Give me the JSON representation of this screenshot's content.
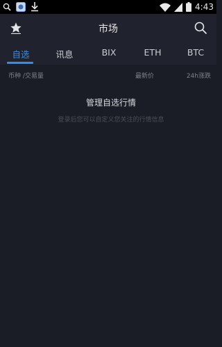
{
  "status_bar": {
    "time": "4:43",
    "icons": [
      "search-icon",
      "app-icon",
      "download-icon",
      "wifi-icon",
      "signal-icon",
      "battery-icon"
    ]
  },
  "header": {
    "title": "市场",
    "left_icon": "star-icon",
    "right_icon": "search-icon"
  },
  "tabs": [
    {
      "label": "自选",
      "active": true
    },
    {
      "label": "讯息",
      "active": false
    },
    {
      "label": "BIX",
      "active": false
    },
    {
      "label": "ETH",
      "active": false
    },
    {
      "label": "BTC",
      "active": false
    }
  ],
  "columns": {
    "pair": "币种 /交易量",
    "price": "最新价",
    "change": "24h涨跌"
  },
  "empty_state": {
    "title": "管理自选行情",
    "hint": "登录后您可以自定义您关注的行情信息"
  },
  "colors": {
    "accent": "#2e8ef2",
    "background": "#1a1d26",
    "header_bg": "#20232d"
  }
}
